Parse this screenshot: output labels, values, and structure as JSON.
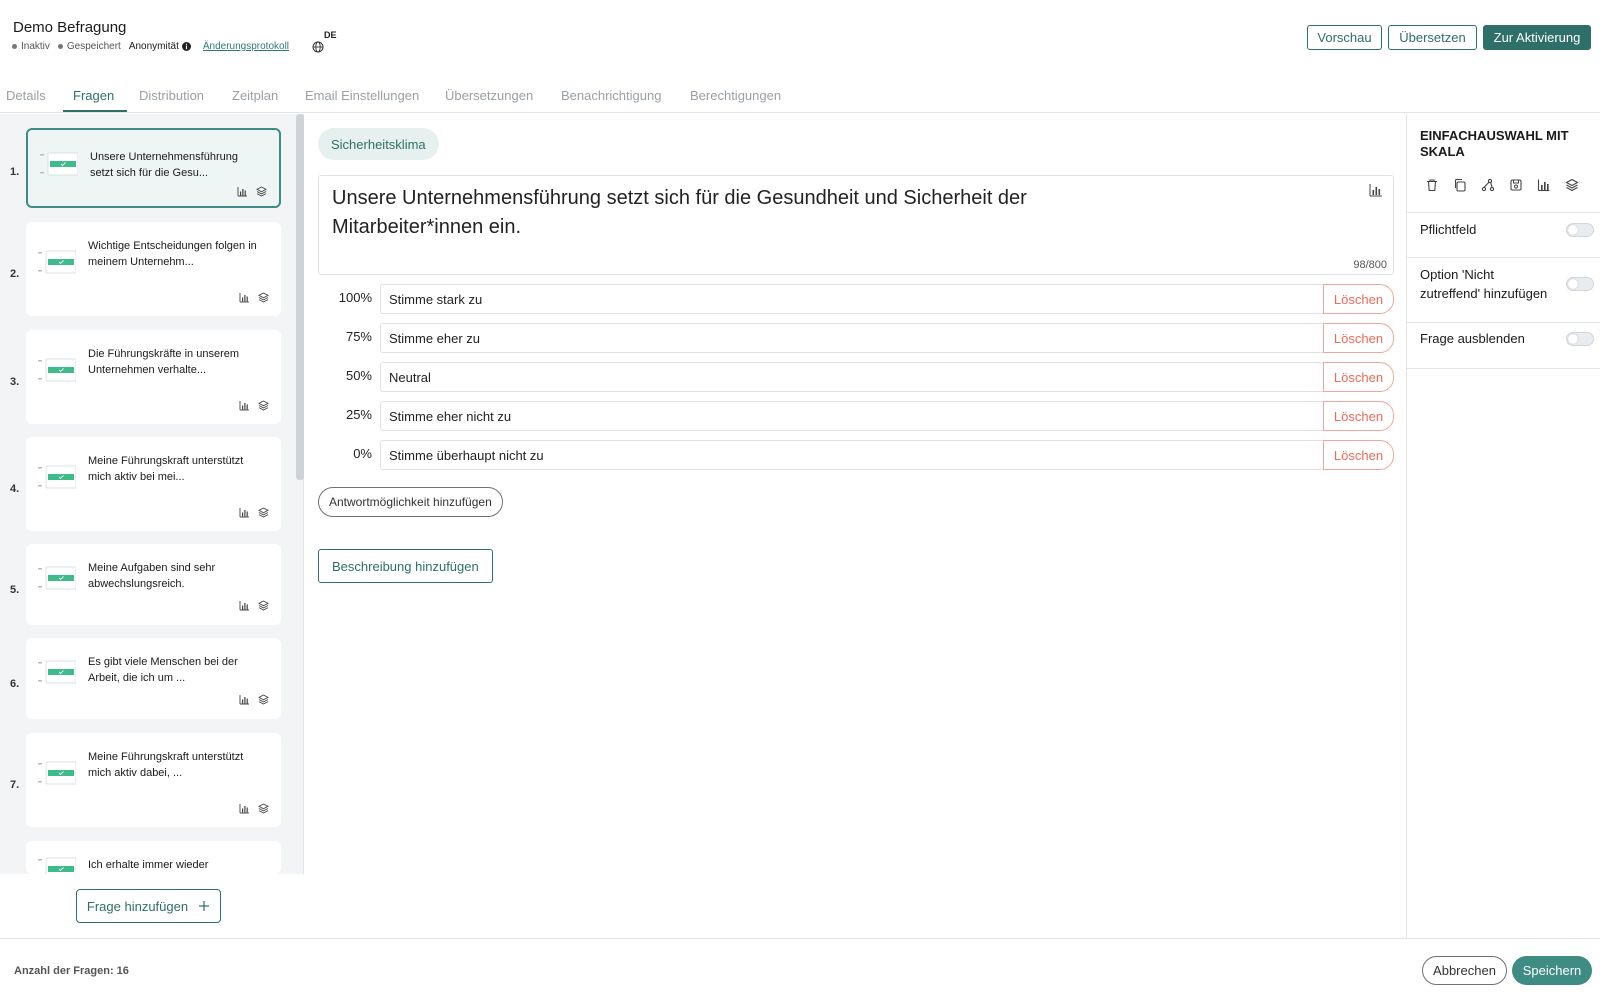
{
  "header": {
    "title": "Demo Befragung",
    "status_inactive": "Inaktiv",
    "status_saved": "Gespeichert",
    "anonymity": "Anonymität",
    "changelog_link": "Änderungsprotokoll",
    "language": "DE",
    "preview_label": "Vorschau",
    "translate_label": "Übersetzen",
    "activate_label": "Zur Aktivierung"
  },
  "tabs": [
    {
      "label": "Details"
    },
    {
      "label": "Fragen"
    },
    {
      "label": "Distribution"
    },
    {
      "label": "Zeitplan"
    },
    {
      "label": "Email Einstellungen"
    },
    {
      "label": "Übersetzungen"
    },
    {
      "label": "Benachrichtigung"
    },
    {
      "label": "Berechtigungen"
    }
  ],
  "active_tab": "Fragen",
  "questions": [
    {
      "num": "1.",
      "text": "Unsere Unternehmensführung setzt sich für die Gesu..."
    },
    {
      "num": "2.",
      "text": "Wichtige Entscheidungen folgen in meinem Unternehm..."
    },
    {
      "num": "3.",
      "text": "Die Führungskräfte in unserem Unternehmen verhalte..."
    },
    {
      "num": "4.",
      "text": "Meine Führungskraft unterstützt mich aktiv bei mei..."
    },
    {
      "num": "5.",
      "text": "Meine Aufgaben sind sehr abwechslungsreich."
    },
    {
      "num": "6.",
      "text": "Es gibt viele Menschen bei der Arbeit, die ich um ..."
    },
    {
      "num": "7.",
      "text": "Meine Führungskraft unterstützt mich aktiv dabei, ..."
    },
    {
      "num": "",
      "text": "Ich erhalte immer wieder"
    }
  ],
  "add_question_label": "Frage hinzufügen",
  "editor": {
    "category": "Sicherheitsklima",
    "question_text": "Unsere Unternehmensführung setzt sich für die Gesundheit und Sicherheit der Mitarbeiter*innen ein.",
    "char_counter": "98/800",
    "options": [
      {
        "pct": "100%",
        "label": "Stimme stark zu",
        "delete": "Löschen"
      },
      {
        "pct": "75%",
        "label": "Stimme eher zu",
        "delete": "Löschen"
      },
      {
        "pct": "50%",
        "label": "Neutral",
        "delete": "Löschen"
      },
      {
        "pct": "25%",
        "label": "Stimme eher nicht zu",
        "delete": "Löschen"
      },
      {
        "pct": "0%",
        "label": "Stimme überhaupt nicht zu",
        "delete": "Löschen"
      }
    ],
    "add_option_label": "Antwortmöglichkeit hinzufügen",
    "add_description_label": "Beschreibung hinzufügen"
  },
  "right_panel": {
    "title": "EINFACHAUSWAHL MIT SKALA",
    "tool_icons": [
      "trash-icon",
      "copy-icon",
      "branch-icon",
      "save-icon",
      "chart-icon",
      "layers-icon"
    ],
    "settings": [
      {
        "label": "Pflichtfeld",
        "enabled": false
      },
      {
        "label": "Option 'Nicht zutreffend' hinzufügen",
        "enabled": false
      },
      {
        "label": "Frage ausblenden",
        "enabled": false
      }
    ]
  },
  "footer": {
    "question_count": "Anzahl der Fragen: 16",
    "cancel_label": "Abbrechen",
    "save_label": "Speichern"
  },
  "colors": {
    "accent": "#2f6f6a",
    "accent_light": "#e6f0ef",
    "delete": "#ef6a5a",
    "thumb_green": "#3dbb8a"
  }
}
